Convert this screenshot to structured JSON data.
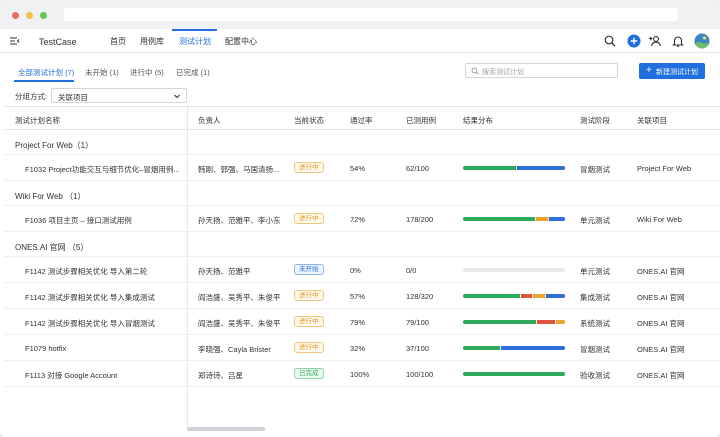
{
  "app": {
    "title": "TestCase"
  },
  "nav": {
    "tabs": [
      {
        "label": "首页"
      },
      {
        "label": "用例库"
      },
      {
        "label": "测试计划"
      },
      {
        "label": "配置中心"
      }
    ]
  },
  "filters": [
    {
      "label": "全部测试计划 (7)"
    },
    {
      "label": "未开始 (1)"
    },
    {
      "label": "进行中 (5)"
    },
    {
      "label": "已完成 (1)"
    }
  ],
  "search": {
    "placeholder": "搜索测试计划"
  },
  "new_button": {
    "label": "新建测试计划"
  },
  "grouping": {
    "label": "分组方式:",
    "value": "关联项目"
  },
  "table": {
    "columns": [
      "测试计划名称",
      "负责人",
      "当前状态",
      "通过率",
      "已测用例",
      "结果分布",
      "测试阶段",
      "关联项目"
    ],
    "groups": [
      {
        "title": "Project For Web（1）",
        "rows": [
          {
            "name": "F1032 Project功能交互与细节优化–冒烟用例...",
            "owner": "韩刚、郭强、马国清扬...",
            "status": "进行中",
            "status_type": "progress",
            "pass_rate": "54%",
            "tested": "62/100",
            "stage": "冒烟测试",
            "project": "Project For Web",
            "dist": [
              {
                "v": 0.53,
                "c": "#2daa5a"
              },
              {
                "v": 0.47,
                "c": "#2f6fd8"
              }
            ]
          }
        ]
      },
      {
        "title": "Wiki For Web （1）",
        "rows": [
          {
            "name": "F1036 项目主页 – 接口测试用例",
            "owner": "孙天扬、范雅平、李小东",
            "status": "进行中",
            "status_type": "progress",
            "pass_rate": "72%",
            "tested": "178/200",
            "stage": "单元测试",
            "project": "Wiki For Web",
            "dist": [
              {
                "v": 0.72,
                "c": "#2daa5a"
              },
              {
                "v": 0.12,
                "c": "#f0a22e"
              },
              {
                "v": 0.16,
                "c": "#2f6fd8"
              }
            ]
          }
        ]
      },
      {
        "title": "ONES.AI 官网 （5）",
        "rows": [
          {
            "name": "F1142 测试步骤相关优化 导入第二轮",
            "owner": "孙天扬、范雅平",
            "status": "未开始",
            "status_type": "notstart",
            "pass_rate": "0%",
            "tested": "0/0",
            "stage": "单元测试",
            "project": "ONES.AI 官网",
            "dist": []
          },
          {
            "name": "F1142 测试步骤相关优化 导入集成测试",
            "owner": "阎浩盛、吴秀平、朱俊平",
            "status": "进行中",
            "status_type": "progress",
            "pass_rate": "57%",
            "tested": "128/320",
            "stage": "集成测试",
            "project": "ONES.AI 官网",
            "dist": [
              {
                "v": 0.57,
                "c": "#2daa5a"
              },
              {
                "v": 0.12,
                "c": "#e0533d"
              },
              {
                "v": 0.12,
                "c": "#f0a22e"
              },
              {
                "v": 0.19,
                "c": "#2f6fd8"
              }
            ]
          },
          {
            "name": "F1142 测试步骤相关优化 导入冒烟测试",
            "owner": "阎浩盛、吴秀平、朱俊平",
            "status": "进行中",
            "status_type": "progress",
            "pass_rate": "79%",
            "tested": "79/100",
            "stage": "系统测试",
            "project": "ONES.AI 官网",
            "dist": [
              {
                "v": 0.73,
                "c": "#2daa5a"
              },
              {
                "v": 0.18,
                "c": "#e0533d"
              },
              {
                "v": 0.09,
                "c": "#f0a22e"
              }
            ]
          },
          {
            "name": "F1079 hotfix",
            "owner": "李晓强、Cayla Brister",
            "status": "进行中",
            "status_type": "progress",
            "pass_rate": "32%",
            "tested": "37/100",
            "stage": "冒烟测试",
            "project": "ONES.AI 官网",
            "dist": [
              {
                "v": 0.37,
                "c": "#2daa5a"
              },
              {
                "v": 0.63,
                "c": "#2f6fd8"
              }
            ]
          },
          {
            "name": "F1113 对接 Google Account",
            "owner": "郑诗诗、吕星",
            "status": "已完成",
            "status_type": "done",
            "pass_rate": "100%",
            "tested": "100/100",
            "stage": "验收测试",
            "project": "ONES.AI 官网",
            "dist": [
              {
                "v": 1.0,
                "c": "#2daa5a"
              }
            ]
          }
        ]
      }
    ]
  }
}
